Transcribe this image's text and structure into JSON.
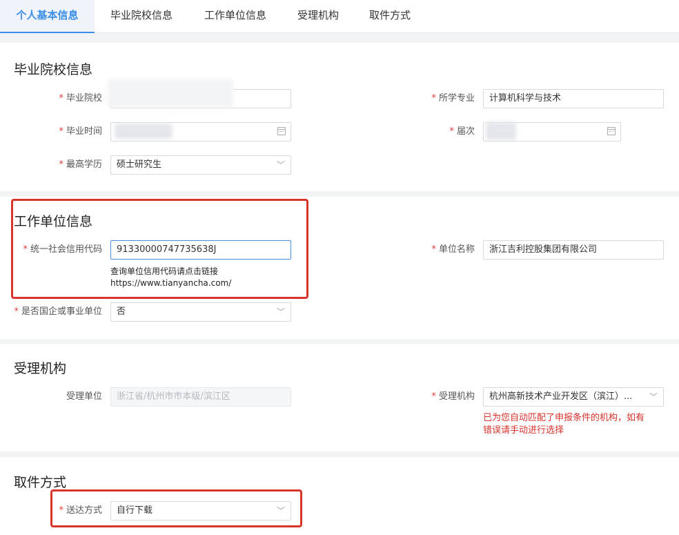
{
  "tabs": [
    {
      "label": "个人基本信息"
    },
    {
      "label": "毕业院校信息"
    },
    {
      "label": "工作单位信息"
    },
    {
      "label": "受理机构"
    },
    {
      "label": "取件方式"
    }
  ],
  "required_mark": "*",
  "graduation": {
    "title": "毕业院校信息",
    "school_label": "毕业院校",
    "school_value": "",
    "major_label": "所学专业",
    "major_value": "计算机科学与技术",
    "grad_time_label": "毕业时间",
    "grad_time_value": "",
    "session_label": "届次",
    "session_value": "",
    "degree_label": "最高学历",
    "degree_value": "硕士研究生"
  },
  "employer": {
    "title": "工作单位信息",
    "credit_code_label": "统一社会信用代码",
    "credit_code_value": "91330000747735638J",
    "company_name_label": "单位名称",
    "company_name_value": "浙江吉利控股集团有限公司",
    "hint_line1": "查询单位信用代码请点击链接",
    "hint_link": "https://www.tianyancha.com/",
    "soe_label": "是否国企或事业单位",
    "soe_value": "否"
  },
  "agency": {
    "title": "受理机构",
    "unit_label": "受理单位",
    "unit_value": "浙江省/杭州市市本级/滨江区",
    "agency_label": "受理机构",
    "agency_value": "杭州高新技术产业开发区（滨江）...",
    "warning_line1": "已为您自动匹配了申报条件的机构，如有",
    "warning_line2": "错误请手动进行选择"
  },
  "delivery": {
    "title": "取件方式",
    "method_label": "送达方式",
    "method_value": "自行下载"
  },
  "icons": {
    "dropdown": "chevron-down-icon",
    "date": "calendar-icon"
  },
  "colors": {
    "accent": "#3a8ee6",
    "required": "#e23b3b",
    "warning": "#d7302a",
    "highlight_box": "#d9342b"
  }
}
